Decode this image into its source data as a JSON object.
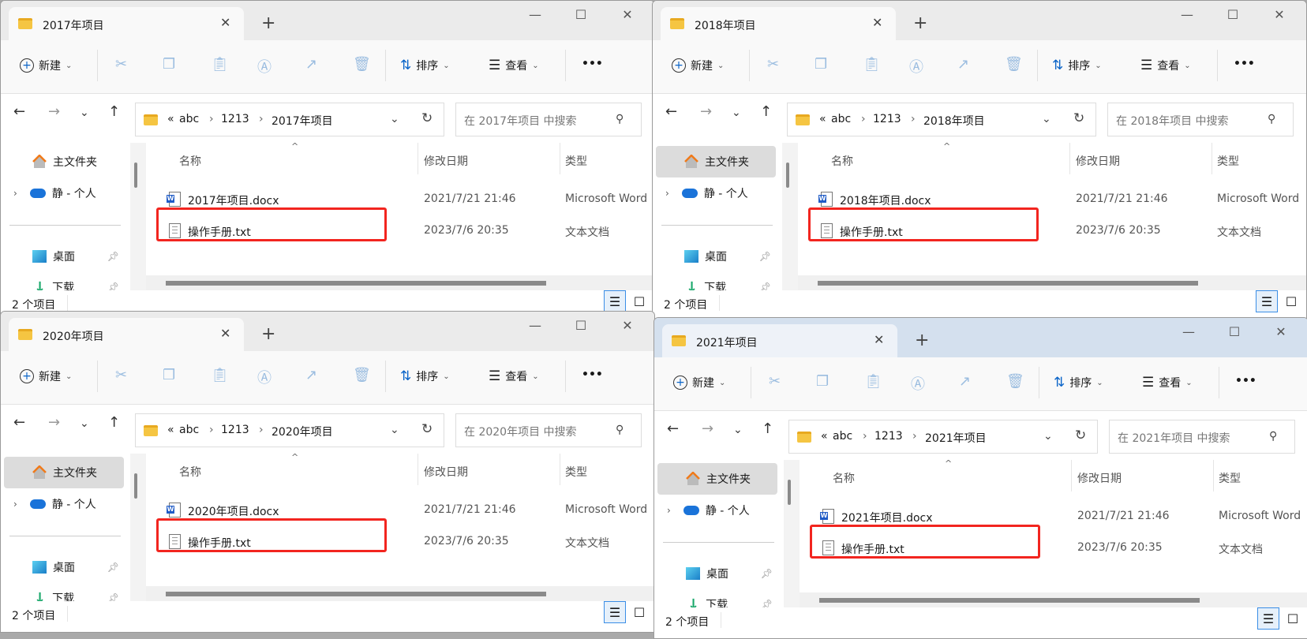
{
  "windows": [
    {
      "title": "2017年项目",
      "active": false,
      "home_selected": false,
      "path": [
        "abc",
        "1213",
        "2017年项目"
      ],
      "search_placeholder": "在 2017年项目 中搜索",
      "files": [
        {
          "name": "2017年项目.docx",
          "date": "2021/7/21 21:46",
          "type": "Microsoft Word",
          "icon": "word-icon"
        },
        {
          "name": "操作手册.txt",
          "date": "2023/7/6 20:35",
          "type": "文本文档",
          "icon": "text-file-icon",
          "highlighted": true
        }
      ],
      "status": "2 个项目"
    },
    {
      "title": "2018年项目",
      "active": false,
      "home_selected": true,
      "path": [
        "abc",
        "1213",
        "2018年项目"
      ],
      "search_placeholder": "在 2018年项目 中搜索",
      "files": [
        {
          "name": "2018年项目.docx",
          "date": "2021/7/21 21:46",
          "type": "Microsoft Word",
          "icon": "word-icon"
        },
        {
          "name": "操作手册.txt",
          "date": "2023/7/6 20:35",
          "type": "文本文档",
          "icon": "text-file-icon",
          "highlighted": true
        }
      ],
      "status": "2 个项目"
    },
    {
      "title": "2020年项目",
      "active": false,
      "home_selected": true,
      "path": [
        "abc",
        "1213",
        "2020年项目"
      ],
      "search_placeholder": "在 2020年项目 中搜索",
      "files": [
        {
          "name": "2020年项目.docx",
          "date": "2021/7/21 21:46",
          "type": "Microsoft Word",
          "icon": "word-icon"
        },
        {
          "name": "操作手册.txt",
          "date": "2023/7/6 20:35",
          "type": "文本文档",
          "icon": "text-file-icon",
          "highlighted": true
        }
      ],
      "status": "2 个项目"
    },
    {
      "title": "2021年项目",
      "active": true,
      "home_selected": true,
      "path": [
        "abc",
        "1213",
        "2021年项目"
      ],
      "search_placeholder": "在 2021年项目 中搜索",
      "files": [
        {
          "name": "2021年项目.docx",
          "date": "2021/7/21 21:46",
          "type": "Microsoft Word",
          "icon": "word-icon"
        },
        {
          "name": "操作手册.txt",
          "date": "2023/7/6 20:35",
          "type": "文本文档",
          "icon": "text-file-icon",
          "highlighted": true
        }
      ],
      "status": "2 个项目"
    }
  ],
  "toolbar": {
    "new": "新建",
    "sort": "排序",
    "view": "查看",
    "more": "•••"
  },
  "nav": {
    "overflow": "«",
    "sep": "›"
  },
  "sidebar": {
    "home": "主文件夹",
    "onedrive": "静 - 个人",
    "desktop": "桌面",
    "downloads": "下载"
  },
  "columns": {
    "name": "名称",
    "date": "修改日期",
    "type": "类型"
  },
  "colors": {
    "highlight": "#f2251f",
    "active_titlebar": "#d4e0ee"
  }
}
